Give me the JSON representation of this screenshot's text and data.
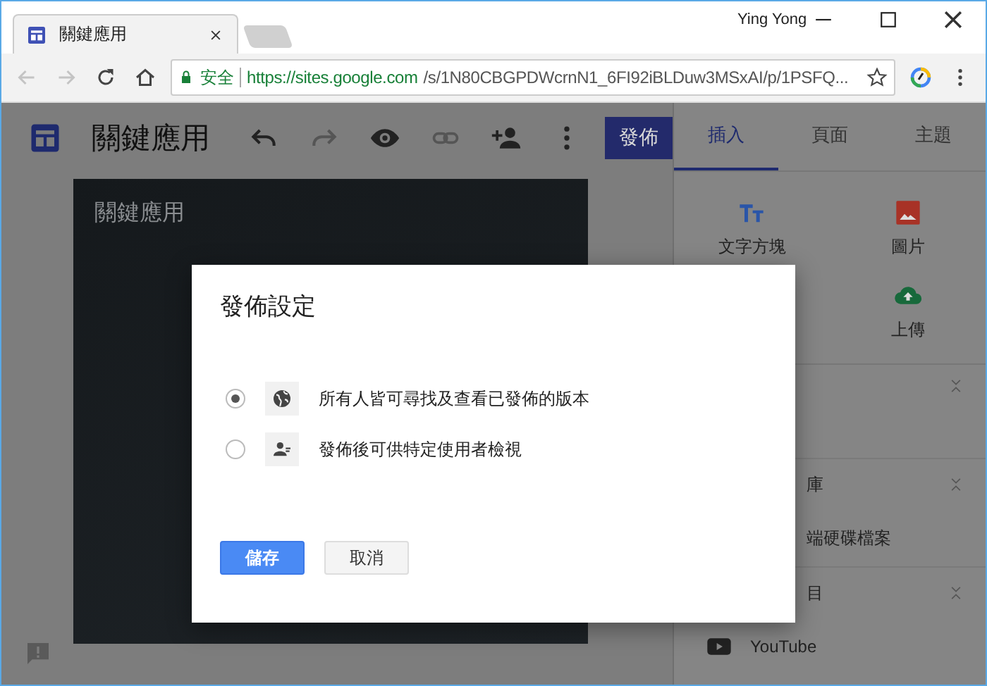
{
  "browser": {
    "tab_title": "關鍵應用",
    "profile": "Ying Yong",
    "security": "安全",
    "url_host": "https://sites.google.com",
    "url_path": "/s/1N80CBGPDWcrnN1_6FI92iBLDuw3MSxAI/p/1PSFQ..."
  },
  "editor": {
    "site_title": "關鍵應用",
    "publish_button": "發佈",
    "hero_title": "關鍵應用"
  },
  "panel": {
    "tabs": [
      {
        "label": "插入",
        "selected": true
      },
      {
        "label": "頁面",
        "selected": false
      },
      {
        "label": "主題",
        "selected": false
      }
    ],
    "insert_items": [
      {
        "label": "文字方塊",
        "kind": "text"
      },
      {
        "label": "圖片",
        "kind": "image"
      },
      {
        "label": "上傳",
        "kind": "upload"
      }
    ],
    "entries": [
      {
        "kind": "section"
      },
      {
        "kind": "section",
        "label": "庫"
      },
      {
        "kind": "item",
        "label": "端硬碟檔案"
      },
      {
        "kind": "section",
        "label": "目"
      },
      {
        "kind": "embed",
        "label": "YouTube"
      }
    ]
  },
  "dialog": {
    "title": "發佈設定",
    "options": [
      {
        "label": "所有人皆可尋找及查看已發佈的版本",
        "kind": "public",
        "selected": true
      },
      {
        "label": "發佈後可供特定使用者檢視",
        "kind": "restricted",
        "selected": false
      }
    ],
    "buttons": [
      {
        "label": "儲存",
        "kind": "primary"
      },
      {
        "label": "取消",
        "kind": "secondary"
      }
    ]
  }
}
